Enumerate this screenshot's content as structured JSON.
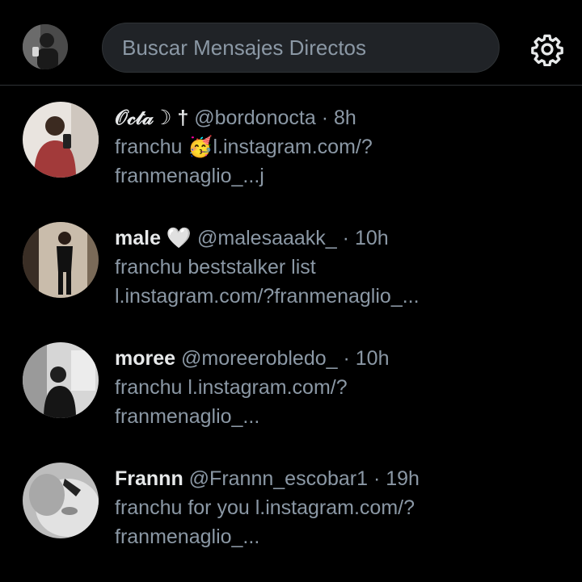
{
  "header": {
    "search_placeholder": "Buscar Mensajes Directos",
    "settings_icon": "gear-icon"
  },
  "conversations": [
    {
      "name": "𝒪𝒸𝓉𝒶☽ †",
      "handle": "@bordonocta",
      "separator": "·",
      "time": "8h",
      "preview_line1": "franchu 🥳l.instagram.com/?",
      "preview_line2": "franmenaglio_...j"
    },
    {
      "name": "male 🤍",
      "handle": "@malesaaakk_",
      "separator": "·",
      "time": "10h",
      "preview_line1": "franchu beststalker list",
      "preview_line2": "l.instagram.com/?franmenaglio_..."
    },
    {
      "name": "moree",
      "handle": "@moreerobledo_",
      "separator": "·",
      "time": "10h",
      "preview_line1": "franchu  l.instagram.com/?",
      "preview_line2": "franmenaglio_..."
    },
    {
      "name": "Frannn",
      "handle": "@Frannn_escobar1",
      "separator": "·",
      "time": "19h",
      "preview_line1": "franchu for you l.instagram.com/?",
      "preview_line2": "franmenaglio_..."
    }
  ]
}
